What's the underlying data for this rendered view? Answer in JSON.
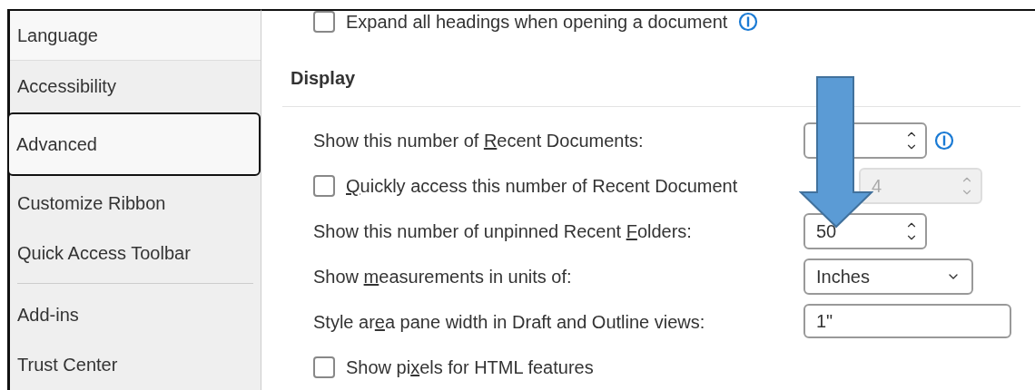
{
  "sidebar": {
    "items": [
      {
        "label": "Language",
        "selected": false
      },
      {
        "label": "Accessibility",
        "selected": false
      },
      {
        "label": "Advanced",
        "selected": true
      },
      {
        "label": "Customize Ribbon",
        "selected": false
      },
      {
        "label": "Quick Access Toolbar",
        "selected": false
      },
      {
        "label": "Add-ins",
        "selected": false
      },
      {
        "label": "Trust Center",
        "selected": false
      }
    ]
  },
  "top_option": {
    "kind": "checkbox",
    "label": {
      "before": "Expand all headings when opening a document"
    },
    "checked": false,
    "info": true
  },
  "section": {
    "title": "Display"
  },
  "options": [
    {
      "kind": "spin",
      "label": {
        "before": "Show this number of ",
        "key": "R",
        "after": "ecent Documents:"
      },
      "disabled": false,
      "info": true
    },
    {
      "kind": "checkbox_spin",
      "label": {
        "key": "Q",
        "after": "uickly access this number of Recent Document"
      },
      "checked": false,
      "value": "4",
      "disabled": true
    },
    {
      "kind": "spin",
      "label": {
        "before": "Show this number of unpinned Recent ",
        "key": "F",
        "after": "olders:"
      },
      "value": "50",
      "disabled": false
    },
    {
      "kind": "dropdown",
      "label": {
        "before": "Show ",
        "key": "m",
        "after": "easurements in units of:"
      },
      "value": "Inches"
    },
    {
      "kind": "text",
      "label": {
        "before": "Style ar",
        "key": "e",
        "after": "a pane width in Draft and Outline views:"
      },
      "value": "1\""
    },
    {
      "kind": "checkbox",
      "label": {
        "before": "Show pi",
        "key": "x",
        "after": "els for HTML features"
      },
      "checked": false
    }
  ]
}
